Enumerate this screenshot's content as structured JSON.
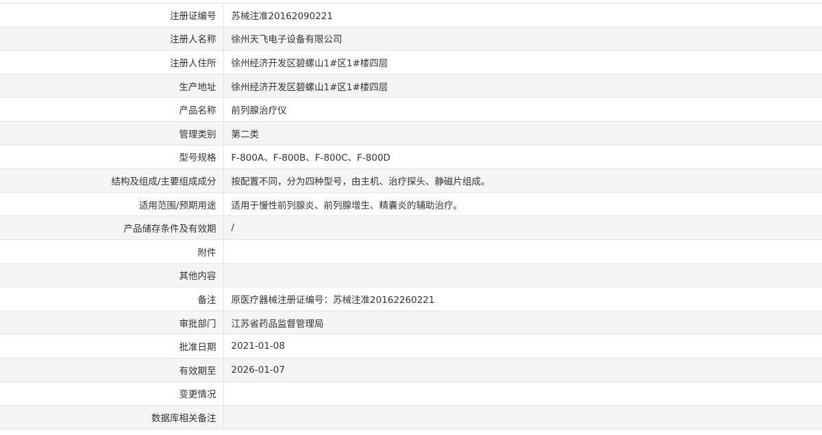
{
  "rows": [
    {
      "label": "注册证编号",
      "value": "苏械注准20162090221"
    },
    {
      "label": "注册人名称",
      "value": "徐州天飞电子设备有限公司"
    },
    {
      "label": "注册人住所",
      "value": "徐州经济开发区碧螺山1#区1#楼四层"
    },
    {
      "label": "生产地址",
      "value": "徐州经济开发区碧螺山1#区1#楼四层"
    },
    {
      "label": "产品名称",
      "value": "前列腺治疗仪"
    },
    {
      "label": "管理类别",
      "value": "第二类"
    },
    {
      "label": "型号规格",
      "value": "F-800A、F-800B、F-800C、F-800D"
    },
    {
      "label": "结构及组成/主要组成成分",
      "value": "按配置不同，分为四种型号，由主机、治疗探头、静磁片组成。"
    },
    {
      "label": "适用范围/预期用途",
      "value": "适用于慢性前列腺炎、前列腺增生、精囊炎的辅助治疗。"
    },
    {
      "label": "产品储存条件及有效期",
      "value": "/"
    },
    {
      "label": "附件",
      "value": ""
    },
    {
      "label": "其他内容",
      "value": ""
    },
    {
      "label": "备注",
      "value": "原医疗器械注册证编号：苏械注准20162260221"
    },
    {
      "label": "审批部门",
      "value": "江苏省药品监督管理局"
    },
    {
      "label": "批准日期",
      "value": "2021-01-08"
    },
    {
      "label": "有效期至",
      "value": "2026-01-07"
    },
    {
      "label": "变更情况",
      "value": ""
    },
    {
      "label": "数据库相关备注",
      "value": ""
    }
  ]
}
